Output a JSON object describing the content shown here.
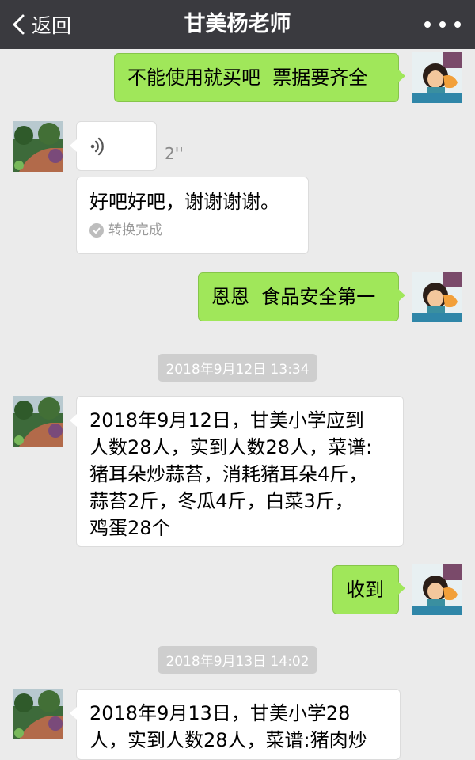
{
  "header": {
    "back_label": "返回",
    "title": "甘美杨老师",
    "more_icon": "more-dots-icon"
  },
  "messages": {
    "m1": "不能使用就买吧  票据要齐全",
    "m2_voice_duration": "2''",
    "m3": "好吧好吧，谢谢谢谢。",
    "m3_status": "转换完成",
    "m4": "恩恩  食品安全第一",
    "ts1": "2018年9月12日 13:34",
    "m5": "2018年9月12日，甘美小学应到\n人数28人，实到人数28人，菜谱:\n猪耳朵炒蒜苔，消耗猪耳朵4斤，\n蒜苔2斤，冬瓜4斤，白菜3斤，\n鸡蛋28个",
    "m6": "收到",
    "ts2": "2018年9月13日 14:02",
    "m7": "2018年9月13日，甘美小学28\n人，实到人数28人，菜谱:猪肉炒"
  },
  "colors": {
    "header_bg": "#3a3a3f",
    "chat_bg": "#ebebeb",
    "outgoing_bubble": "#a0e75a",
    "incoming_bubble": "#ffffff"
  }
}
